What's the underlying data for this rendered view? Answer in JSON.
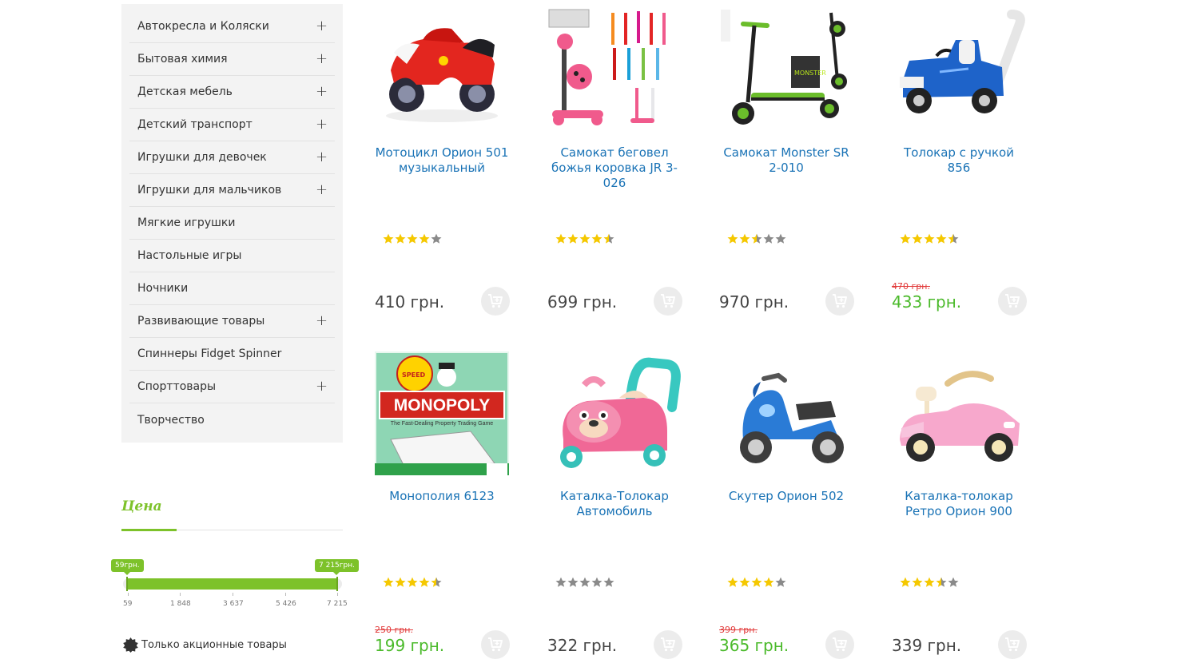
{
  "categories": [
    {
      "label": "Автокресла и Коляски",
      "expandable": true
    },
    {
      "label": "Бытовая химия",
      "expandable": true
    },
    {
      "label": "Детская мебель",
      "expandable": true
    },
    {
      "label": "Детский транспорт",
      "expandable": true
    },
    {
      "label": "Игрушки для девочек",
      "expandable": true
    },
    {
      "label": "Игрушки для мальчиков",
      "expandable": true
    },
    {
      "label": "Мягкие игрушки",
      "expandable": false
    },
    {
      "label": "Настольные игры",
      "expandable": false
    },
    {
      "label": "Ночники",
      "expandable": false
    },
    {
      "label": "Развивающие товары",
      "expandable": true
    },
    {
      "label": "Спиннеры Fidget Spinner",
      "expandable": false
    },
    {
      "label": "Спорттовары",
      "expandable": true
    },
    {
      "label": "Творчество",
      "expandable": false
    }
  ],
  "expand_symbol": "+",
  "price_filter": {
    "title": "Цена",
    "min_label": "59грн.",
    "max_label": "7 215грн.",
    "scale": [
      "59",
      "1 848",
      "3 637",
      "5 426",
      "7 215"
    ],
    "promo_only_label": "Только акционные товары"
  },
  "colors": {
    "accent_green": "#7dc22a",
    "link_blue": "#1a73b6",
    "sale_green": "#4bba2b",
    "old_price_red": "#e13a3a",
    "star_gold": "#f5c800",
    "star_grey": "#8a8a8a"
  },
  "products": [
    {
      "title": "Мотоцикл Орион 501 музыкальный",
      "rating": 4,
      "old_price": "",
      "price": "410 грн.",
      "sale": false,
      "image": "red-ride-on-motorcycle"
    },
    {
      "title": "Самокат беговел божья коровка JR 3-026",
      "rating": 4.5,
      "old_price": "",
      "price": "699 грн.",
      "sale": false,
      "image": "ladybug-kick-scooters"
    },
    {
      "title": "Самокат Monster SR 2-010",
      "rating": 2.5,
      "old_price": "",
      "price": "970 грн.",
      "sale": false,
      "image": "black-green-scooter"
    },
    {
      "title": "Толокар с ручкой 856",
      "rating": 4.5,
      "old_price": "470 грн.",
      "price": "433 грн.",
      "sale": true,
      "image": "blue-ride-on-car-push-handle"
    },
    {
      "title": "Монополия 6123",
      "rating": 4.5,
      "old_price": "250 грн.",
      "price": "199 грн.",
      "sale": true,
      "image": "monopoly-box"
    },
    {
      "title": "Каталка-Толокар Автомобиль",
      "rating": 0,
      "old_price": "",
      "price": "322 грн.",
      "sale": false,
      "image": "pink-puppy-ride-on"
    },
    {
      "title": "Скутер Орион 502",
      "rating": 4,
      "old_price": "399 грн.",
      "price": "365 грн.",
      "sale": true,
      "image": "blue-ride-on-scooter"
    },
    {
      "title": "Каталка-толокар Ретро Орион 900",
      "rating": 3.5,
      "old_price": "",
      "price": "339 грн.",
      "sale": false,
      "image": "pink-retro-car"
    }
  ],
  "monopoly_logo_text": "MONOPOLY",
  "monopoly_tagline": "The Fast-Dealing Property Trading Game"
}
